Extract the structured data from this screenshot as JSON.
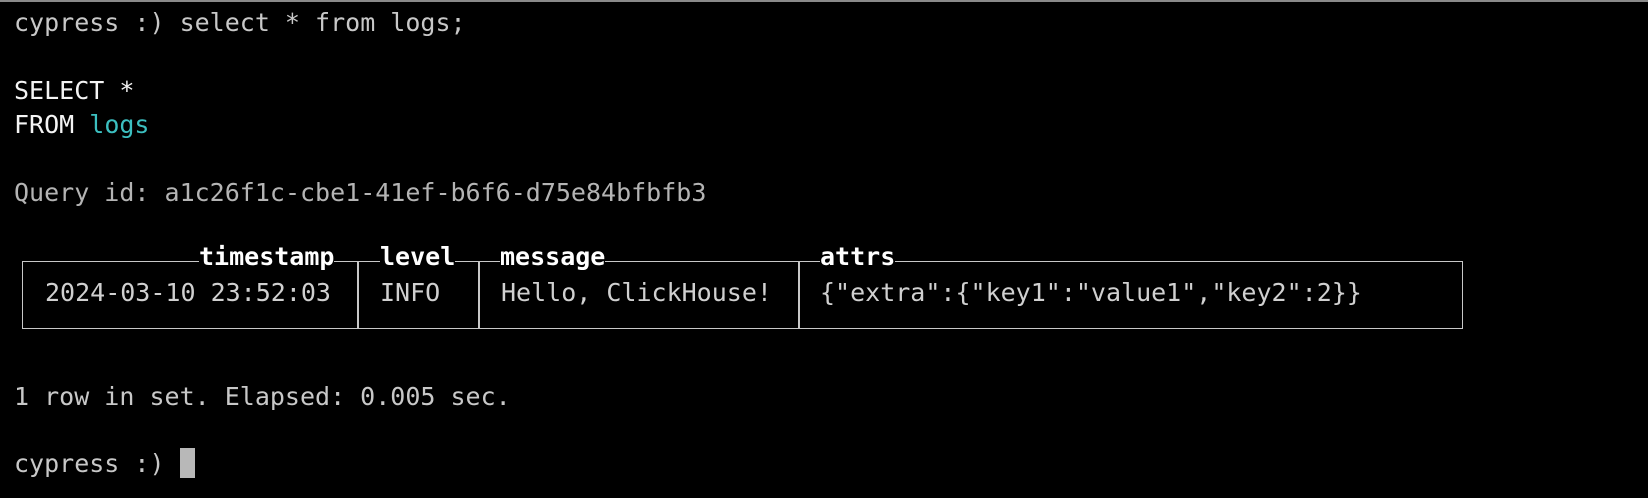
{
  "terminal": {
    "prompt": "cypress :)",
    "command": "select * from logs;",
    "formatted_query": {
      "line1_keyword": "SELECT",
      "line1_rest": "*",
      "line2_keyword": "FROM",
      "line2_table": "logs"
    },
    "query_id_label": "Query id:",
    "query_id": "a1c26f1c-cbe1-41ef-b6f6-d75e84bfbfb3",
    "result": {
      "columns": [
        "timestamp",
        "level",
        "message",
        "attrs"
      ],
      "rows": [
        [
          "2024-03-10 23:52:03",
          "INFO",
          "Hello, ClickHouse!",
          "{\"extra\":{\"key1\":\"value1\",\"key2\":2}}"
        ]
      ]
    },
    "summary": "1 row in set. Elapsed: 0.005 sec.",
    "second_prompt": "cypress :)"
  },
  "colors": {
    "background": "#000000",
    "text": "#c8c8c8",
    "keyword": "#f4f4f4",
    "table_name": "#3cbfc0",
    "cursor": "#b8b8b8"
  }
}
